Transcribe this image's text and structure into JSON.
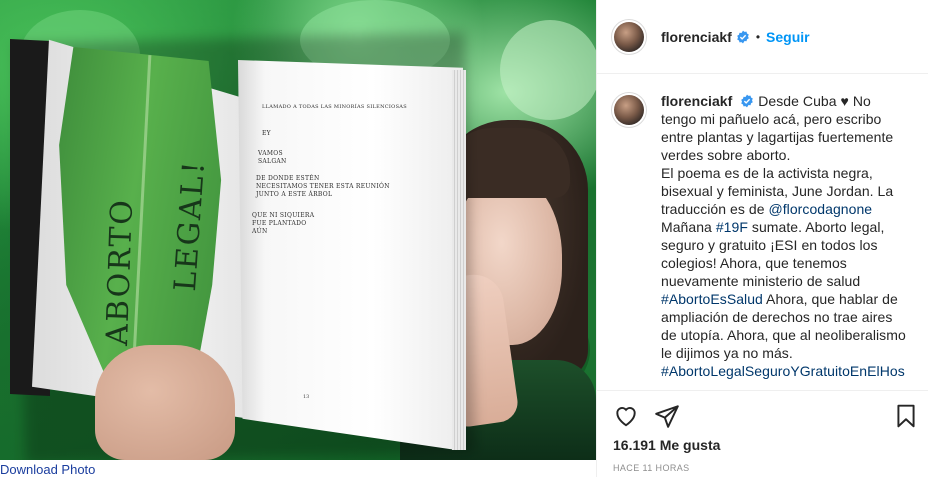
{
  "photo": {
    "leaf_text_1": "ABORTO",
    "leaf_text_2": "LEGAL!",
    "poem_title": "LLAMADO A TODAS LAS MINORÍAS SILENCIOSAS",
    "poem_line_1": "EY",
    "poem_line_2": "VAMOS\nSALGAN",
    "poem_line_3": "DE DONDE ESTÉN\nNECESITAMOS TENER ESTA REUNIÓN\nJUNTO A ESTE ÁRBOL",
    "poem_line_4": "QUE NI SIQUIERA\nFUE PLANTADO\nAÚN",
    "page_number": "13"
  },
  "download_link": "Download Photo",
  "header": {
    "username": "florenciakf",
    "separator": "•",
    "follow_label": "Seguir"
  },
  "caption": {
    "username": "florenciakf",
    "lines": [
      "Desde Cuba ♥ No",
      "tengo mi pañuelo acá, pero escribo",
      "entre plantas y lagartijas fuertemente",
      "verdes sobre aborto.",
      "El poema es de la activista negra,",
      "bisexual y feminista, June Jordan. La",
      "traducción es de ",
      "Mañana ",
      "seguro y gratuito ¡ESI en todos los",
      "colegios! Ahora, que tenemos",
      "nuevamente ministerio de salud",
      " Ahora, que hablar de",
      "ampliación de derechos no trae aires",
      "de utopía. Ahora, que al neoliberalismo",
      "le dijimos ya no más."
    ],
    "mention": "@florcodagnone",
    "tag_19f": "#19F",
    "line_8_rest": " sumate. Aborto legal,",
    "tag_aborto_salud": "#AbortoEsSalud",
    "tag_last": "#AbortoLegalSeguroYGratuitoEnElHos"
  },
  "actions": {
    "likes": "16.191 Me gusta",
    "time": "HACE 11 HORAS"
  },
  "colors": {
    "link": "#0095f6",
    "hashtag": "#00376b",
    "text": "#262626",
    "muted": "#8e8e8e",
    "verified": "#3897f0"
  },
  "icons": [
    "verified-icon",
    "heart-icon",
    "share-icon",
    "save-icon"
  ]
}
